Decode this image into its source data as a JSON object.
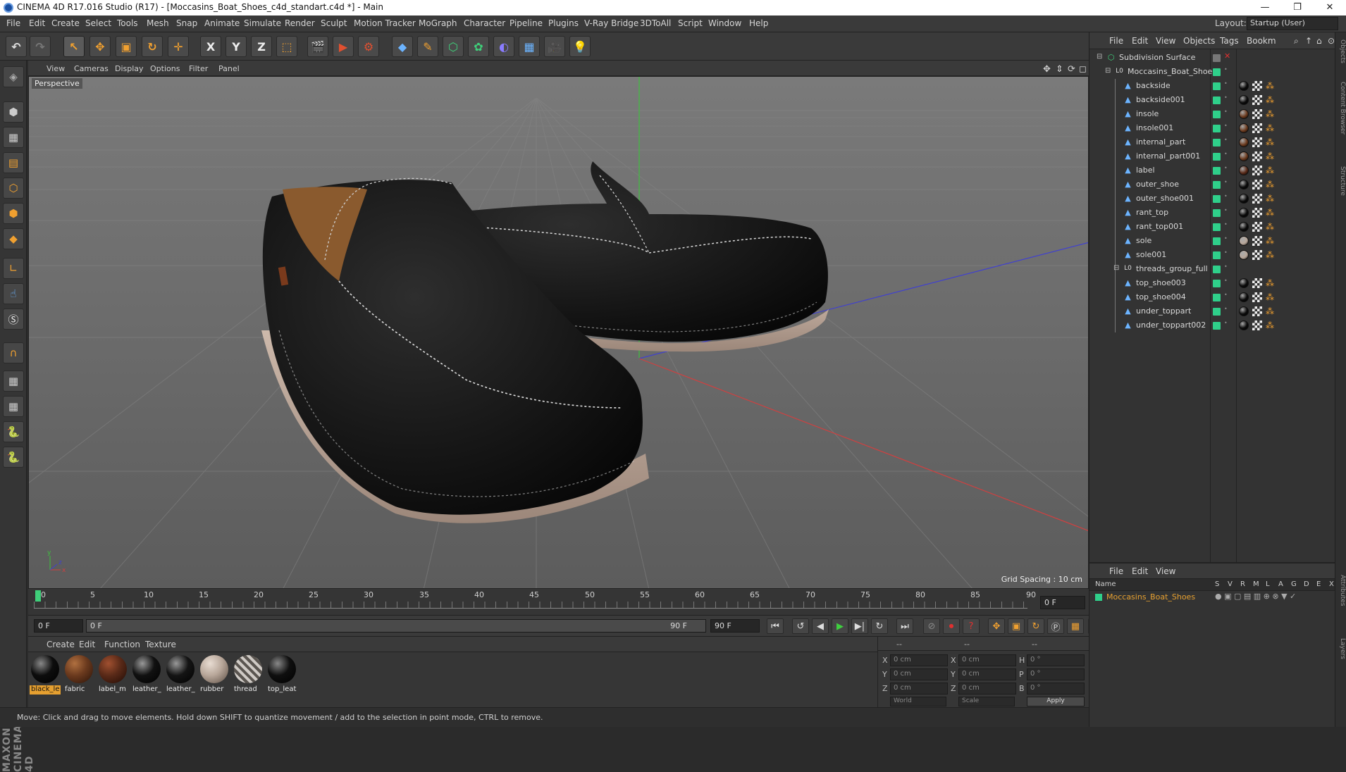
{
  "window": {
    "title": "CINEMA 4D R17.016 Studio (R17) - [Moccasins_Boat_Shoes_c4d_standart.c4d *] - Main",
    "min_glyph": "—",
    "max_glyph": "❐",
    "close_glyph": "✕"
  },
  "menu": [
    "File",
    "Edit",
    "Create",
    "Select",
    "Tools",
    "Mesh",
    "Snap",
    "Animate",
    "Simulate",
    "Render",
    "Sculpt",
    "Motion Tracker",
    "MoGraph",
    "Character",
    "Pipeline",
    "Plugins",
    "V-Ray Bridge",
    "3DToAll",
    "Script",
    "Window",
    "Help"
  ],
  "layout": {
    "label": "Layout:",
    "value": "Startup (User)"
  },
  "toolbar": {
    "axis_x": "X",
    "axis_y": "Y",
    "axis_z": "Z"
  },
  "viewport": {
    "menu": [
      "View",
      "Cameras",
      "Display",
      "Options",
      "Filter",
      "Panel"
    ],
    "camera_label": "Perspective",
    "grid_spacing": "Grid Spacing : 10 cm"
  },
  "timeline": {
    "ticks": [
      "0",
      "5",
      "10",
      "15",
      "20",
      "25",
      "30",
      "35",
      "40",
      "45",
      "50",
      "55",
      "60",
      "65",
      "70",
      "75",
      "80",
      "85",
      "90"
    ],
    "current_frame_field": "0 F",
    "start_field": "0 F",
    "range_start": "0 F",
    "range_end": "90 F",
    "end_field": "90 F"
  },
  "materials": {
    "menu": [
      "Create",
      "Edit",
      "Function",
      "Texture"
    ],
    "items": [
      {
        "label": "black_le",
        "color": "#0d0d0d",
        "selected": true
      },
      {
        "label": "fabric",
        "color": "#6b3a1e",
        "selected": false
      },
      {
        "label": "label_m",
        "color": "#5a2a18",
        "selected": false
      },
      {
        "label": "leather_",
        "color": "#111111",
        "selected": false
      },
      {
        "label": "leather_",
        "color": "#141414",
        "selected": false
      },
      {
        "label": "rubber",
        "color": "#b8a79a",
        "selected": false
      },
      {
        "label": "thread",
        "color": "#8a8580",
        "selected": false
      },
      {
        "label": "top_leat",
        "color": "#0f0f0f",
        "selected": false
      }
    ]
  },
  "coords": {
    "header": [
      "--",
      "--",
      "--"
    ],
    "rows": [
      {
        "a": "X",
        "v1": "0 cm",
        "b": "X",
        "v2": "0 cm",
        "c": "H",
        "v3": "0 °"
      },
      {
        "a": "Y",
        "v1": "0 cm",
        "b": "Y",
        "v2": "0 cm",
        "c": "P",
        "v3": "0 °"
      },
      {
        "a": "Z",
        "v1": "0 cm",
        "b": "Z",
        "v2": "0 cm",
        "c": "B",
        "v3": "0 °"
      }
    ],
    "mode1": "World",
    "mode2": "Scale",
    "apply": "Apply"
  },
  "status": "Move: Click and drag to move elements. Hold down SHIFT to quantize movement / add to the selection in point mode, CTRL to remove.",
  "objects": {
    "menu": [
      "File",
      "Edit",
      "View",
      "Objects",
      "Tags",
      "Bookm"
    ],
    "rows": [
      {
        "name": "Subdivision Surface",
        "indent": 0,
        "icon": "subdivision-icon",
        "glyph": "⬡",
        "tag": "none"
      },
      {
        "name": "Moccasins_Boat_Shoes",
        "indent": 1,
        "icon": "null-icon",
        "glyph": "L0",
        "tag": "none"
      },
      {
        "name": "backside",
        "indent": 2,
        "icon": "polygon-icon",
        "glyph": "▲",
        "tag": "#0b0b0b"
      },
      {
        "name": "backside001",
        "indent": 2,
        "icon": "polygon-icon",
        "glyph": "▲",
        "tag": "#0b0b0b"
      },
      {
        "name": "insole",
        "indent": 2,
        "icon": "polygon-icon",
        "glyph": "▲",
        "tag": "#6b3a1e"
      },
      {
        "name": "insole001",
        "indent": 2,
        "icon": "polygon-icon",
        "glyph": "▲",
        "tag": "#6b3a1e"
      },
      {
        "name": "internal_part",
        "indent": 2,
        "icon": "polygon-icon",
        "glyph": "▲",
        "tag": "#6b3a1e"
      },
      {
        "name": "internal_part001",
        "indent": 2,
        "icon": "polygon-icon",
        "glyph": "▲",
        "tag": "#6b3a1e"
      },
      {
        "name": "label",
        "indent": 2,
        "icon": "polygon-icon",
        "glyph": "▲",
        "tag": "#5a2a18"
      },
      {
        "name": "outer_shoe",
        "indent": 2,
        "icon": "polygon-icon",
        "glyph": "▲",
        "tag": "#0b0b0b"
      },
      {
        "name": "outer_shoe001",
        "indent": 2,
        "icon": "polygon-icon",
        "glyph": "▲",
        "tag": "#0b0b0b"
      },
      {
        "name": "rant_top",
        "indent": 2,
        "icon": "polygon-icon",
        "glyph": "▲",
        "tag": "#0b0b0b"
      },
      {
        "name": "rant_top001",
        "indent": 2,
        "icon": "polygon-icon",
        "glyph": "▲",
        "tag": "#0b0b0b"
      },
      {
        "name": "sole",
        "indent": 2,
        "icon": "polygon-icon",
        "glyph": "▲",
        "tag": "#b8a79a"
      },
      {
        "name": "sole001",
        "indent": 2,
        "icon": "polygon-icon",
        "glyph": "▲",
        "tag": "#b8a79a"
      },
      {
        "name": "threads_group_full",
        "indent": 2,
        "icon": "null-icon",
        "glyph": "L0",
        "tag": "none"
      },
      {
        "name": "top_shoe003",
        "indent": 2,
        "icon": "polygon-icon",
        "glyph": "▲",
        "tag": "#0b0b0b"
      },
      {
        "name": "top_shoe004",
        "indent": 2,
        "icon": "polygon-icon",
        "glyph": "▲",
        "tag": "#0b0b0b"
      },
      {
        "name": "under_toppart",
        "indent": 2,
        "icon": "polygon-icon",
        "glyph": "▲",
        "tag": "#0b0b0b"
      },
      {
        "name": "under_toppart002",
        "indent": 2,
        "icon": "polygon-icon",
        "glyph": "▲",
        "tag": "#0b0b0b"
      }
    ]
  },
  "layers": {
    "menu": [
      "File",
      "Edit",
      "View"
    ],
    "columns": [
      "Name",
      "S",
      "V",
      "R",
      "M",
      "L",
      "A",
      "G",
      "D",
      "E",
      "X"
    ],
    "row_name": "Moccasins_Boat_Shoes",
    "row_color": "#2fcf8a"
  },
  "side_tabs": [
    "Objects",
    "Content Browser",
    "Structure",
    "Attributes",
    "Layers"
  ]
}
